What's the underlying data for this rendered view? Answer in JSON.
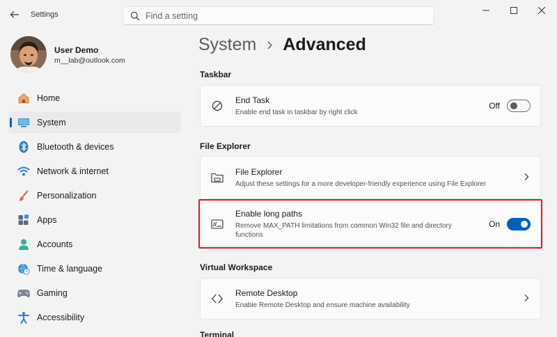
{
  "window": {
    "title": "Settings",
    "controls": [
      "minimize",
      "maximize",
      "close"
    ]
  },
  "search": {
    "placeholder": "Find a setting",
    "value": ""
  },
  "user": {
    "name": "User Demo",
    "email": "m__lab@outlook.com"
  },
  "sidebar": {
    "items": [
      {
        "label": "Home",
        "icon": "home-icon",
        "active": false
      },
      {
        "label": "System",
        "icon": "system-monitor-icon",
        "active": true
      },
      {
        "label": "Bluetooth & devices",
        "icon": "bluetooth-icon",
        "active": false
      },
      {
        "label": "Network & internet",
        "icon": "wifi-icon",
        "active": false
      },
      {
        "label": "Personalization",
        "icon": "brush-icon",
        "active": false
      },
      {
        "label": "Apps",
        "icon": "apps-icon",
        "active": false
      },
      {
        "label": "Accounts",
        "icon": "account-icon",
        "active": false
      },
      {
        "label": "Time & language",
        "icon": "globe-clock-icon",
        "active": false
      },
      {
        "label": "Gaming",
        "icon": "gamepad-icon",
        "active": false
      },
      {
        "label": "Accessibility",
        "icon": "accessibility-icon",
        "active": false
      }
    ]
  },
  "breadcrumb": {
    "parent": "System",
    "current": "Advanced"
  },
  "sections": {
    "taskbar": {
      "heading": "Taskbar",
      "end_task": {
        "title": "End Task",
        "description": "Enable end task in taskbar by right click",
        "state_label": "Off",
        "on": false
      }
    },
    "file_explorer": {
      "heading": "File Explorer",
      "file_explorer": {
        "title": "File Explorer",
        "description": "Adjust these settings for a more developer-friendly experience using File Explorer"
      },
      "long_paths": {
        "title": "Enable long paths",
        "description_line1": "Remove MAX_PATH limitations from common Win32 file and directory",
        "description_line2": "functions",
        "state_label": "On",
        "on": true
      }
    },
    "virtual_workspace": {
      "heading": "Virtual Workspace",
      "remote_desktop": {
        "title": "Remote Desktop",
        "description": "Enable Remote Desktop and ensure machine availability"
      }
    },
    "next": {
      "heading": "Terminal"
    }
  },
  "colors": {
    "accent": "#005fb8",
    "highlight": "#d3202a",
    "background": "#f3f3f3",
    "card": "#fbfbfb"
  }
}
